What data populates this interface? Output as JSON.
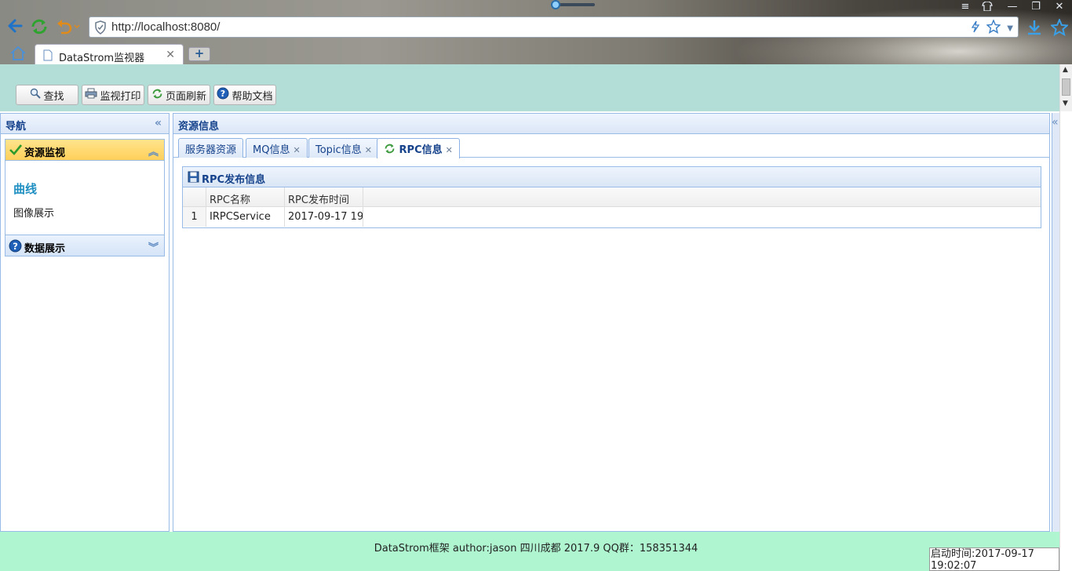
{
  "browser": {
    "url": "http://localhost:8080/",
    "tab_title": "DataStrom监视器",
    "new_tab": "+"
  },
  "toolbar": {
    "find": "查找",
    "print": "监视打印",
    "refresh": "页面刷新",
    "help": "帮助文档"
  },
  "nav": {
    "title": "导航",
    "groups": [
      {
        "label": "资源监视",
        "items": [
          "曲线",
          "图像展示"
        ]
      },
      {
        "label": "数据展示"
      }
    ]
  },
  "main": {
    "title": "资源信息",
    "tabs": [
      {
        "label": "服务器资源"
      },
      {
        "label": "MQ信息"
      },
      {
        "label": "Topic信息"
      },
      {
        "label": "RPC信息"
      }
    ],
    "grid": {
      "title": "RPC发布信息",
      "columns": [
        "RPC名称",
        "RPC发布时间"
      ],
      "rows": [
        {
          "index": "1",
          "name": "IRPCService",
          "time": "2017-09-17 19"
        }
      ]
    }
  },
  "footer": {
    "text": "DataStrom框架 author:jason 四川成都 2017.9 QQ群：158351344",
    "status_line1": "启动时间:2017-09-17",
    "status_line2": "19:02:07"
  },
  "colors": {
    "north_bg": "#b3ddd7",
    "south_bg": "#aef5d0",
    "accent": "#15428b",
    "selected_group": "#ffd05a"
  }
}
